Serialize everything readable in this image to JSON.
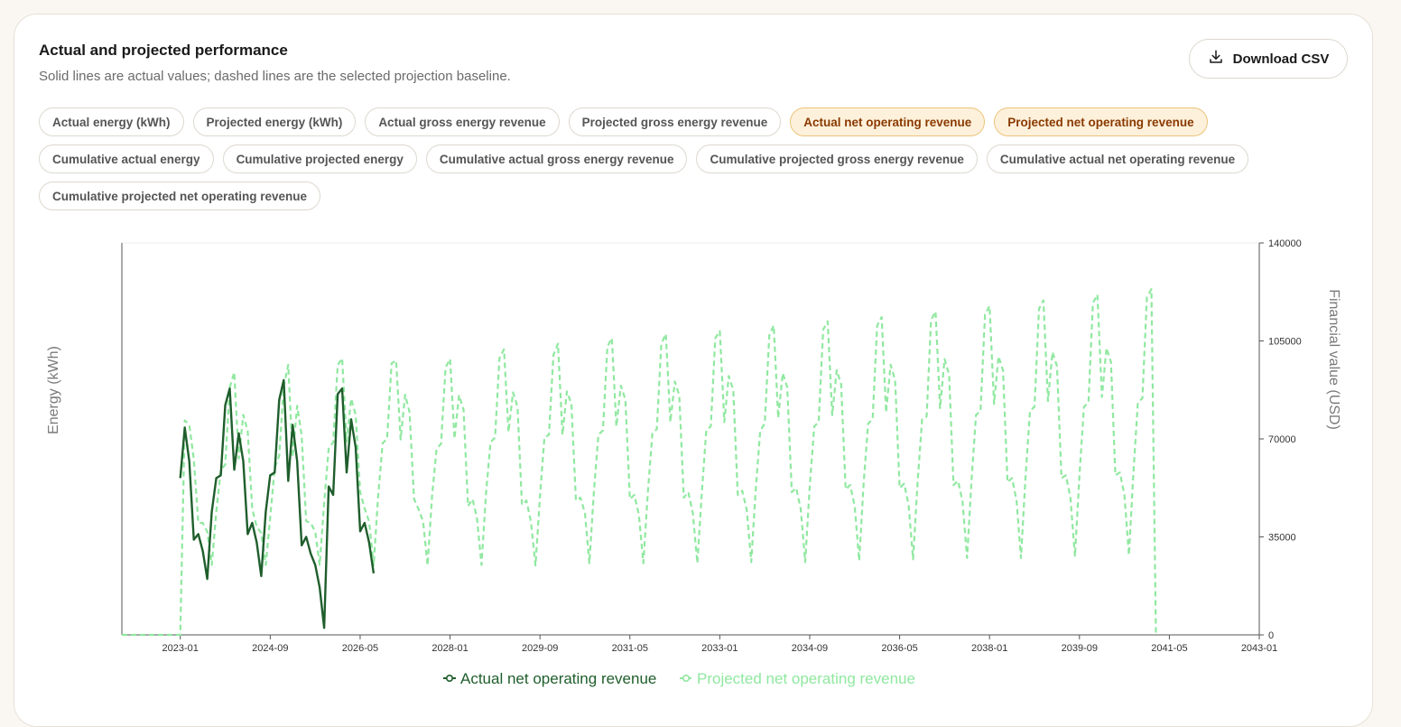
{
  "card": {
    "title": "Actual and projected performance",
    "subtitle": "Solid lines are actual values; dashed lines are the selected projection baseline.",
    "download_label": "Download CSV"
  },
  "chips": [
    [
      {
        "label": "Actual energy (kWh)",
        "active": false
      },
      {
        "label": "Projected energy (kWh)",
        "active": false
      },
      {
        "label": "Actual gross energy revenue",
        "active": false
      },
      {
        "label": "Projected gross energy revenue",
        "active": false
      },
      {
        "label": "Actual net operating revenue",
        "active": true
      },
      {
        "label": "Projected net operating revenue",
        "active": true
      }
    ],
    [
      {
        "label": "Cumulative actual energy",
        "active": false
      },
      {
        "label": "Cumulative projected energy",
        "active": false
      },
      {
        "label": "Cumulative actual gross energy revenue",
        "active": false
      },
      {
        "label": "Cumulative projected gross energy revenue",
        "active": false
      },
      {
        "label": "Cumulative actual net operating revenue",
        "active": false
      }
    ],
    [
      {
        "label": "Cumulative projected net operating revenue",
        "active": false
      }
    ]
  ],
  "colors": {
    "actual": "#1f5e2c",
    "projected": "#90e8a0",
    "chip_active_bg": "#fdf1dc",
    "chip_active_text": "#8a3a00"
  },
  "chart_data": {
    "type": "line",
    "ylabel_left": "Energy (kWh)",
    "ylabel_right": "Financial value (USD)",
    "x_ticks": [
      "2023-01",
      "2024-09",
      "2026-05",
      "2028-01",
      "2029-09",
      "2031-05",
      "2033-01",
      "2034-09",
      "2036-05",
      "2038-01",
      "2039-09",
      "2041-05",
      "2043-01"
    ],
    "xlim": [
      "2021-12",
      "2043-01"
    ],
    "y_right_ticks": [
      0,
      35000,
      70000,
      105000,
      140000
    ],
    "y_right_lim": [
      0,
      140000
    ],
    "grid": false,
    "legend_position": "bottom",
    "series": [
      {
        "name": "Actual net operating revenue",
        "style": "solid",
        "axis": "right",
        "start": "2023-01",
        "values": [
          56000,
          74000,
          62000,
          34000,
          36000,
          30000,
          20000,
          44000,
          56000,
          57000,
          82000,
          88000,
          59000,
          72000,
          62000,
          36000,
          40000,
          33000,
          21000,
          44000,
          57000,
          58000,
          84000,
          91000,
          55000,
          75000,
          62000,
          32000,
          35000,
          29000,
          25000,
          17000,
          2500,
          53000,
          50000,
          86000,
          88000,
          58000,
          77000,
          67000,
          37000,
          40000,
          33000,
          22000
        ]
      },
      {
        "name": "Projected net operating revenue",
        "style": "dashed",
        "axis": "right",
        "start": "2021-12",
        "values": [
          0,
          0,
          0,
          0,
          0,
          0,
          0,
          0,
          0,
          0,
          0,
          0,
          0,
          0,
          76600,
          75000,
          62700,
          40000,
          40000,
          36800,
          25000,
          44000,
          58800,
          60800,
          88400,
          93800,
          63000,
          78600,
          72800,
          45000,
          38600,
          36400,
          25000,
          41800,
          59600,
          64000,
          88800,
          96500,
          63500,
          81800,
          71200,
          40600,
          40000,
          36900,
          25000,
          47000,
          66600,
          68800,
          96400,
          98800,
          69100,
          84400,
          78600,
          51000,
          45200,
          40500,
          24800,
          49500,
          68500,
          70000,
          97000,
          98000,
          69800,
          85800,
          79500,
          48500,
          44900,
          40500,
          24800,
          49500,
          66400,
          68300,
          95500,
          98500,
          70100,
          85600,
          80500,
          46000,
          48500,
          41600,
          25000,
          50500,
          68800,
          70500,
          98900,
          102000,
          72500,
          86600,
          81500,
          46500,
          48000,
          40300,
          24800,
          49500,
          70500,
          71500,
          100000,
          104000,
          71500,
          87000,
          82500,
          48000,
          49000,
          43500,
          25600,
          51000,
          71500,
          73000,
          103000,
          106000,
          74500,
          89000,
          84000,
          48500,
          50000,
          43000,
          25600,
          51000,
          72000,
          73500,
          104000,
          107500,
          76000,
          90500,
          85500,
          49000,
          51000,
          43500,
          25600,
          51000,
          73000,
          74500,
          106000,
          108500,
          76000,
          92500,
          87500,
          50000,
          51500,
          44500,
          26000,
          52000,
          73000,
          75500,
          107000,
          110500,
          77500,
          93500,
          88500,
          51000,
          52500,
          45000,
          26000,
          53000,
          74500,
          76000,
          109000,
          112000,
          78500,
          94500,
          89500,
          52000,
          53500,
          46000,
          26500,
          54000,
          75500,
          77000,
          110500,
          113500,
          79500,
          96500,
          91000,
          52500,
          54000,
          46500,
          27000,
          54500,
          77000,
          78000,
          112500,
          115500,
          81000,
          98500,
          93000,
          53500,
          55000,
          47500,
          27500,
          55500,
          78500,
          80000,
          114500,
          117500,
          82500,
          99500,
          94500,
          54500,
          56000,
          48000,
          27500,
          56000,
          80000,
          81500,
          116500,
          119500,
          83500,
          101000,
          96000,
          56000,
          57000,
          49000,
          28000,
          57000,
          81500,
          83000,
          118500,
          121500,
          85000,
          102500,
          97500,
          57000,
          58000,
          50000,
          28500,
          58000,
          83000,
          84500,
          120500,
          123500,
          0
        ]
      }
    ]
  },
  "legend": {
    "actual": "Actual net operating revenue",
    "projected": "Projected net operating revenue"
  }
}
